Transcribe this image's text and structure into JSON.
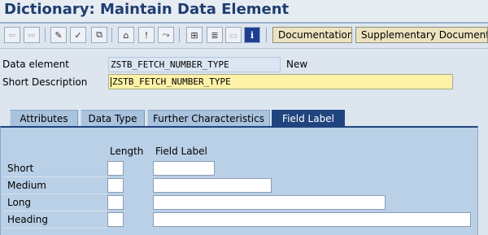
{
  "title": "Dictionary: Maintain Data Element",
  "toolbar": {
    "icons": [
      "back-arrow-icon",
      "forward-arrow-icon",
      "edit-glasses-icon",
      "check-icon",
      "activate-icon",
      "where-used-icon",
      "info-icon",
      "navigation-icon",
      "hierarchy-icon",
      "print-icon",
      "blank-icon",
      "information-icon"
    ],
    "documentation_label": "Documentation",
    "supplementary_label": "Supplementary Documentation"
  },
  "header": {
    "data_element_label": "Data element",
    "data_element_value": "ZSTB_FETCH_NUMBER_TYPE",
    "status": "New",
    "short_description_label": "Short Description",
    "short_description_value": "ZSTB_FETCH_NUMBER_TYPE"
  },
  "tabs": [
    {
      "label": "Attributes",
      "active": false
    },
    {
      "label": "Data Type",
      "active": false
    },
    {
      "label": "Further Characteristics",
      "active": false
    },
    {
      "label": "Field Label",
      "active": true
    }
  ],
  "field_label": {
    "col_length": "Length",
    "col_field_label": "Field Label",
    "rows": [
      {
        "label": "Short",
        "length": "",
        "field_label": ""
      },
      {
        "label": "Medium",
        "length": "",
        "field_label": ""
      },
      {
        "label": "Long",
        "length": "",
        "field_label": ""
      },
      {
        "label": "Heading",
        "length": "",
        "field_label": ""
      }
    ]
  },
  "colors": {
    "title": "#1f3d70",
    "active_tab": "#20457e",
    "panel": "#b9d0e6",
    "edit_field": "#fdf2a8"
  }
}
